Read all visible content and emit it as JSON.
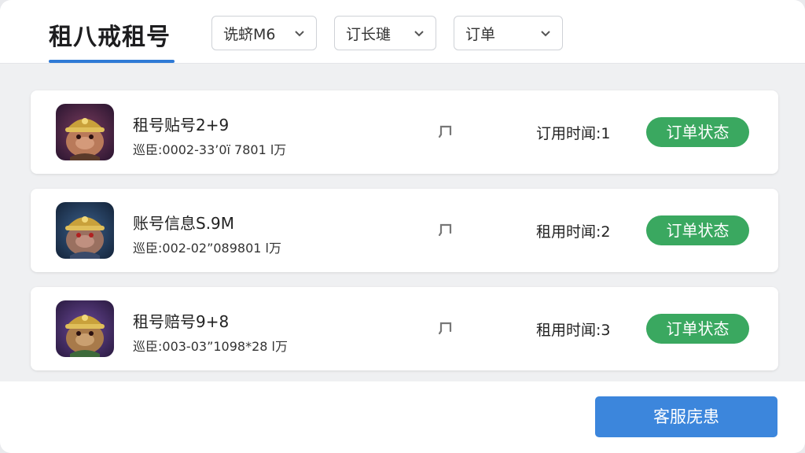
{
  "header": {
    "title": "租八戒租号",
    "filters": [
      {
        "label": "诜蛴M6",
        "icon": "chevron-down-icon"
      },
      {
        "label": "订长璡",
        "icon": "chevron-down-icon"
      },
      {
        "label": "订单",
        "icon": "chevron-down-icon"
      }
    ]
  },
  "accounts": [
    {
      "name": "租号贴号2+9",
      "price": "巡臣:0002-33’0ï 7801 l万",
      "rent_time": "订用时闻:1",
      "status_label": "订单状态",
      "avatar_icon": "game-hero-avatar-icon"
    },
    {
      "name": "账号信息S.9M",
      "price": "巡臣:002-02”089801 l万",
      "rent_time": "租用时闻:2",
      "status_label": "订单状态",
      "avatar_icon": "game-hero-avatar-icon"
    },
    {
      "name": "租号赔号9+8",
      "price": "巡臣:003-03”1098*28 l万",
      "rent_time": "租用时闻:3",
      "status_label": "订单状态",
      "avatar_icon": "game-hero-avatar-icon"
    }
  ],
  "footer": {
    "service_label": "客服庑患"
  },
  "colors": {
    "accent": "#2f7ad6",
    "status_green": "#3aa860",
    "service_blue": "#3c86dc"
  }
}
